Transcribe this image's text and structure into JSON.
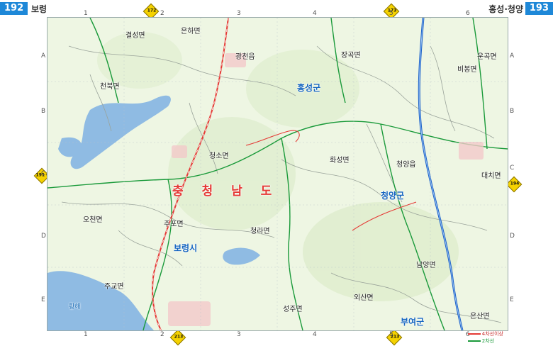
{
  "header": {
    "left_page": "192",
    "left_title": "보령",
    "right_page": "193",
    "right_title": "홍성·청양"
  },
  "margin": {
    "top_numbers": [
      "1",
      "2",
      "3",
      "4",
      "5",
      "6"
    ],
    "bottom_numbers": [
      "1",
      "2",
      "3",
      "4",
      "5",
      "6"
    ],
    "left_letters": [
      "A",
      "B",
      "C",
      "D",
      "E"
    ],
    "right_letters": [
      "A",
      "B",
      "C",
      "D",
      "E"
    ]
  },
  "shields": {
    "top": [
      "172",
      "173"
    ],
    "left": [
      "191 C"
    ],
    "right": [
      "194"
    ],
    "bottom": [
      "213",
      "213"
    ]
  },
  "labels": {
    "province": "충 청 남 도",
    "counties": [
      "홍성군",
      "청양군",
      "보령시",
      "부여군"
    ],
    "towns": [
      "결성면",
      "은하면",
      "광천읍",
      "장곡면",
      "운곡면",
      "비봉면",
      "천북면",
      "청소면",
      "화성면",
      "청양읍",
      "대치면",
      "오천면",
      "주포면",
      "청라면",
      "남양면",
      "주교면",
      "외산면",
      "성주면",
      "은산면"
    ],
    "water": [
      "황해"
    ]
  },
  "legend": {
    "line1": "4차선이상",
    "line2": "2차선"
  },
  "colors": {
    "badge": "#1e88d8",
    "province_label": "#e53935",
    "county_label": "#1565c0",
    "expressway": "#1e63c8",
    "national_road": "#1a9a3a",
    "railway": "#e53935",
    "water": "#8fbbe3",
    "land": "#eef6e3",
    "shield": "#f5d200"
  }
}
